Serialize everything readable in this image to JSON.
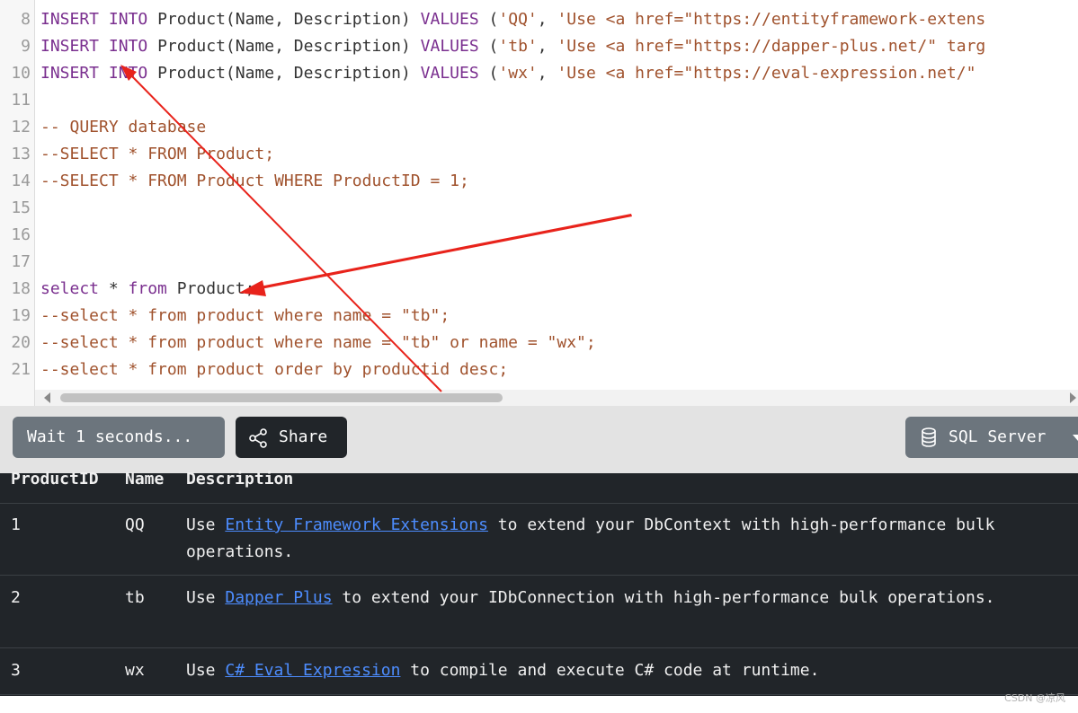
{
  "editor": {
    "lines": [
      {
        "n": "8",
        "segments": [
          {
            "t": "INSERT",
            "c": "kw"
          },
          {
            "t": " ",
            "c": "plain"
          },
          {
            "t": "INTO",
            "c": "kw"
          },
          {
            "t": " Product(Name, Description) ",
            "c": "plain"
          },
          {
            "t": "VALUES",
            "c": "kw"
          },
          {
            "t": " (",
            "c": "plain"
          },
          {
            "t": "'QQ'",
            "c": "str"
          },
          {
            "t": ", ",
            "c": "plain"
          },
          {
            "t": "'Use <a href=\"https://entityframework-extens",
            "c": "str"
          }
        ]
      },
      {
        "n": "9",
        "segments": [
          {
            "t": "INSERT",
            "c": "kw"
          },
          {
            "t": " ",
            "c": "plain"
          },
          {
            "t": "INTO",
            "c": "kw"
          },
          {
            "t": " Product(Name, Description) ",
            "c": "plain"
          },
          {
            "t": "VALUES",
            "c": "kw"
          },
          {
            "t": " (",
            "c": "plain"
          },
          {
            "t": "'tb'",
            "c": "str"
          },
          {
            "t": ", ",
            "c": "plain"
          },
          {
            "t": "'Use <a href=\"https://dapper-plus.net/\" targ",
            "c": "str"
          }
        ]
      },
      {
        "n": "10",
        "segments": [
          {
            "t": "INSERT",
            "c": "kw"
          },
          {
            "t": " ",
            "c": "plain"
          },
          {
            "t": "INTO",
            "c": "kw"
          },
          {
            "t": " Product(Name, Description) ",
            "c": "plain"
          },
          {
            "t": "VALUES",
            "c": "kw"
          },
          {
            "t": " (",
            "c": "plain"
          },
          {
            "t": "'wx'",
            "c": "str"
          },
          {
            "t": ", ",
            "c": "plain"
          },
          {
            "t": "'Use <a href=\"https://eval-expression.net/\" ",
            "c": "str"
          }
        ]
      },
      {
        "n": "11",
        "segments": []
      },
      {
        "n": "12",
        "segments": [
          {
            "t": "-- QUERY database",
            "c": "cmt"
          }
        ]
      },
      {
        "n": "13",
        "segments": [
          {
            "t": "--SELECT * FROM Product;",
            "c": "cmt"
          }
        ]
      },
      {
        "n": "14",
        "segments": [
          {
            "t": "--SELECT * FROM Product WHERE ProductID = 1;",
            "c": "cmt"
          }
        ]
      },
      {
        "n": "15",
        "segments": []
      },
      {
        "n": "16",
        "segments": []
      },
      {
        "n": "17",
        "segments": []
      },
      {
        "n": "18",
        "segments": [
          {
            "t": "select",
            "c": "kw"
          },
          {
            "t": " * ",
            "c": "plain"
          },
          {
            "t": "from",
            "c": "kw"
          },
          {
            "t": " Product;",
            "c": "plain"
          }
        ]
      },
      {
        "n": "19",
        "segments": [
          {
            "t": "--select * from product where name = \"tb\";",
            "c": "cmt"
          }
        ]
      },
      {
        "n": "20",
        "segments": [
          {
            "t": "--select * from product where name = \"tb\" or name = \"wx\";",
            "c": "cmt"
          }
        ]
      },
      {
        "n": "21",
        "segments": [
          {
            "t": "--select * from product order by productid desc;",
            "c": "cmt"
          }
        ]
      }
    ]
  },
  "toolbar": {
    "wait_label": "Wait 1 seconds...",
    "share_label": "Share",
    "db_label": "SQL Server"
  },
  "results": {
    "columns": [
      "ProductID",
      "Name",
      "Description"
    ],
    "rows": [
      {
        "id": "1",
        "name": "QQ",
        "pre": "Use ",
        "link": "Entity Framework Extensions",
        "post": " to extend your DbContext with high-performance bulk operations."
      },
      {
        "id": "2",
        "name": "tb",
        "pre": "Use ",
        "link": "Dapper Plus",
        "post": " to extend your IDbConnection with high-performance bulk operations."
      },
      {
        "id": "3",
        "name": "wx",
        "pre": "Use ",
        "link": "C# Eval Expression",
        "post": " to compile and execute C# code at runtime."
      }
    ]
  },
  "watermark": "CSDN @凉风",
  "colors": {
    "keyword": "#7a2f8f",
    "string": "#a0522d",
    "comment": "#a0522d",
    "link": "#4d8dff",
    "annotation_arrow": "#e8231b",
    "results_bg": "#212529"
  },
  "icons": {
    "share": "share-icon",
    "database": "database-icon",
    "dropdown": "chevron-down-icon"
  }
}
